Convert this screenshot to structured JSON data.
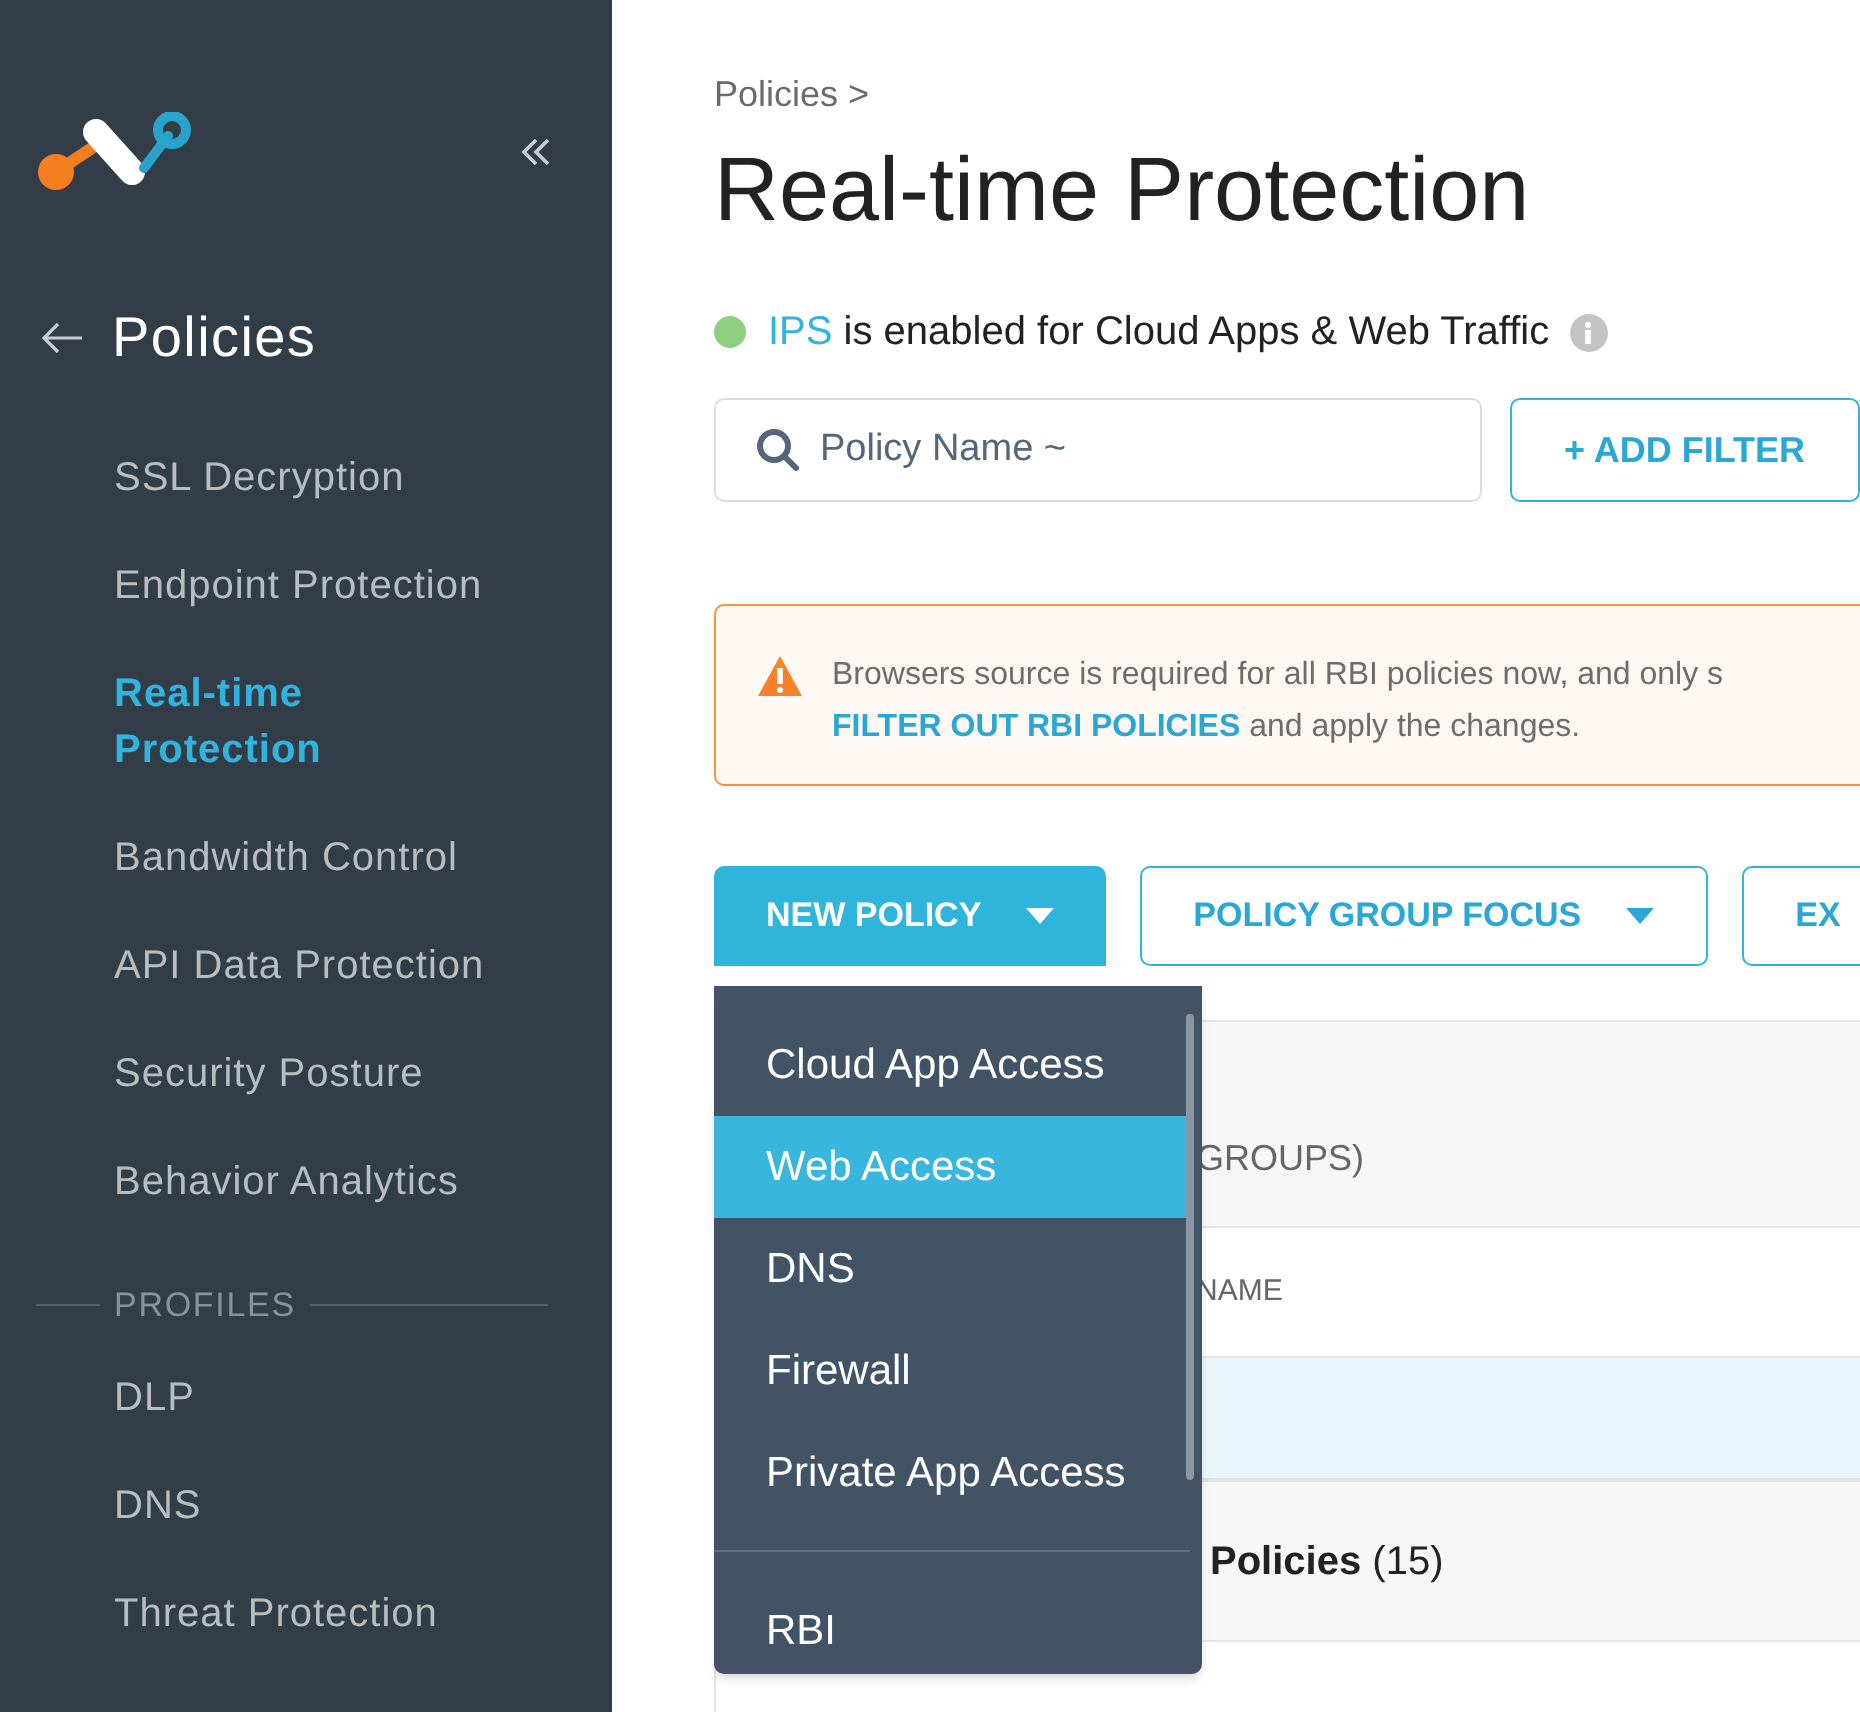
{
  "sidebar": {
    "back_label": "Policies",
    "items": [
      {
        "label": "SSL Decryption",
        "selected": false
      },
      {
        "label": "Endpoint Protection",
        "selected": false
      },
      {
        "label": "Real-time Protection",
        "selected": true
      },
      {
        "label": "Bandwidth Control",
        "selected": false
      },
      {
        "label": "API Data Protection",
        "selected": false
      },
      {
        "label": "Security Posture",
        "selected": false
      },
      {
        "label": "Behavior Analytics",
        "selected": false
      }
    ],
    "section": "PROFILES",
    "profile_items": [
      {
        "label": "DLP",
        "selected": false
      },
      {
        "label": "DNS",
        "selected": false
      },
      {
        "label": "Threat Protection",
        "selected": false
      }
    ]
  },
  "breadcrumb": "Policies >",
  "title": "Real-time Protection",
  "status": {
    "enabled": true,
    "name": "IPS",
    "text": "is enabled for Cloud Apps & Web Traffic"
  },
  "search": {
    "placeholder": "Policy Name ~"
  },
  "add_filter": "+ ADD FILTER",
  "alert": {
    "text": "Browsers source is required for all RBI policies now, and only s",
    "link": "FILTER OUT RBI POLICIES",
    "text_after": "and apply the changes."
  },
  "buttons": [
    {
      "label": "NEW POLICY",
      "kind": "primary",
      "dropdown": true
    },
    {
      "label": "POLICY GROUP FOCUS",
      "kind": "outline",
      "dropdown": true
    },
    {
      "label": "EX",
      "kind": "outline",
      "dropdown": false
    }
  ],
  "menu": {
    "items": [
      {
        "label": "Cloud App Access",
        "selected": false
      },
      {
        "label": "Web Access",
        "selected": true
      },
      {
        "label": "DNS",
        "selected": false
      },
      {
        "label": "Firewall",
        "selected": false
      },
      {
        "label": "Private App Access",
        "selected": false
      }
    ],
    "footer_items": [
      {
        "label": "RBI",
        "selected": false
      }
    ]
  },
  "table": {
    "summary": "GROUPS)",
    "column": "NAME",
    "group": {
      "name": "Policies",
      "count": "(15)"
    }
  }
}
